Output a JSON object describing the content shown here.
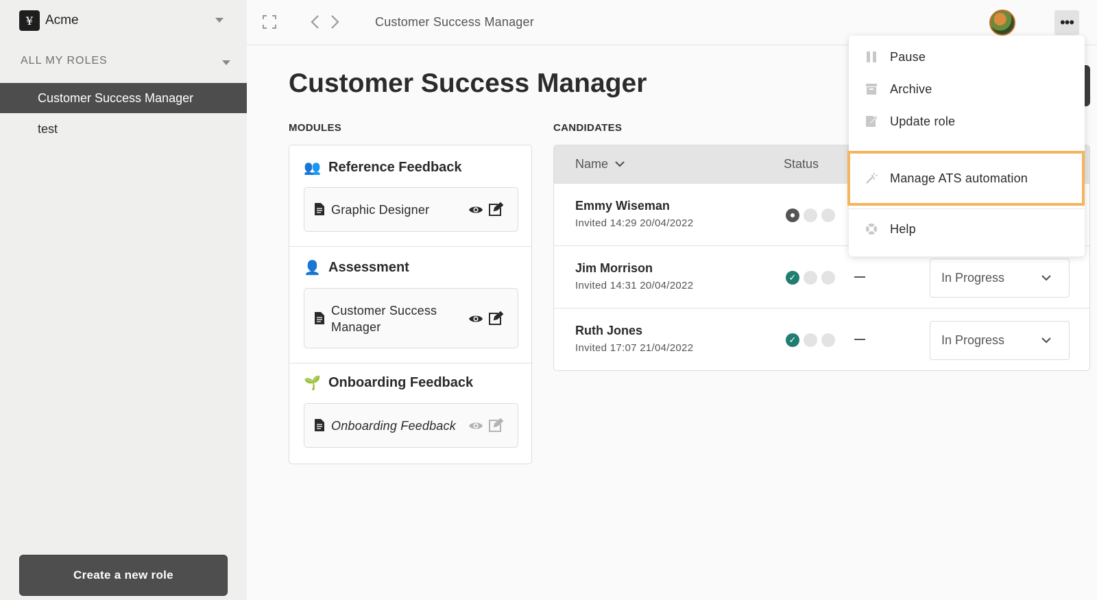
{
  "sidebar": {
    "org_logo": "¥",
    "org_name": "Acme",
    "roles_header": "ALL MY ROLES",
    "items": [
      {
        "label": "Customer Success Manager",
        "active": true
      },
      {
        "label": "test",
        "active": false
      }
    ],
    "create_button": "Create a new role"
  },
  "topbar": {
    "breadcrumb": "Customer Success Manager",
    "more_label": "•••"
  },
  "main": {
    "title": "Customer Success Manager",
    "modules_label": "MODULES",
    "candidates_label": "CANDIDATES",
    "modules": [
      {
        "icon": "👥",
        "icon_name": "people-icon",
        "title": "Reference Feedback",
        "item": "Graphic Designer",
        "italic": false
      },
      {
        "icon": "👤",
        "icon_name": "person-icon",
        "title": "Assessment",
        "item": "Customer Success Manager",
        "italic": false
      },
      {
        "icon": "🌱",
        "icon_name": "seedling-icon",
        "title": "Onboarding Feedback",
        "item": "Onboarding Feedback",
        "italic": true
      }
    ],
    "table": {
      "col_name": "Name",
      "col_status": "Status",
      "rows": [
        {
          "name": "Emmy Wiseman",
          "invited": "Invited 14:29 20/04/2022",
          "progress": [
            "current",
            "todo",
            "todo"
          ],
          "select": ""
        },
        {
          "name": "Jim Morrison",
          "invited": "Invited 14:31 20/04/2022",
          "progress": [
            "done",
            "todo",
            "todo"
          ],
          "select": "In Progress"
        },
        {
          "name": "Ruth Jones",
          "invited": "Invited 17:07 21/04/2022",
          "progress": [
            "done",
            "todo",
            "todo"
          ],
          "select": "In Progress"
        }
      ]
    }
  },
  "menu": {
    "items": [
      {
        "label": "Pause",
        "icon": "pause-icon"
      },
      {
        "label": "Archive",
        "icon": "archive-icon"
      },
      {
        "label": "Update role",
        "icon": "edit-document-icon"
      },
      {
        "label": "Manage ATS automation",
        "icon": "magic-wand-icon"
      },
      {
        "label": "Help",
        "icon": "lifebuoy-icon"
      }
    ]
  },
  "colors": {
    "sidebar_bg": "#efefee",
    "active_item": "#4d4d4d",
    "done_green": "#1f7d72",
    "highlight": "#f3b55d"
  }
}
